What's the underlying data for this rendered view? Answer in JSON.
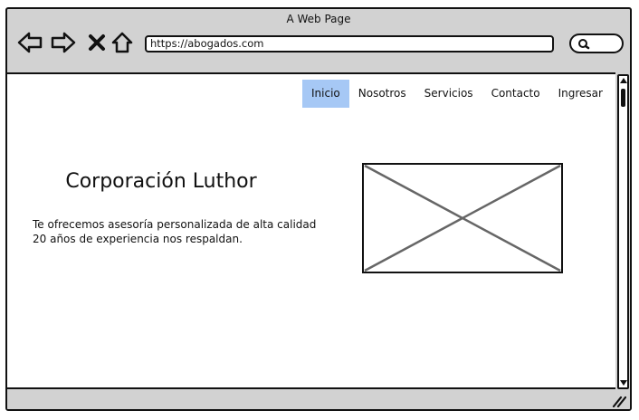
{
  "window": {
    "title": "A Web Page"
  },
  "toolbar": {
    "icons": [
      "back-icon",
      "forward-icon",
      "close-icon",
      "home-icon",
      "search-icon"
    ],
    "url": "https://abogados.com"
  },
  "nav": {
    "items": [
      {
        "label": "Inicio",
        "active": true
      },
      {
        "label": "Nosotros",
        "active": false
      },
      {
        "label": "Servicios",
        "active": false
      },
      {
        "label": "Contacto",
        "active": false
      },
      {
        "label": "Ingresar",
        "active": false
      }
    ],
    "active_color": "#a6c8f5"
  },
  "hero": {
    "title": "Corporación Luthor",
    "lines": [
      "Te ofrecemos asesoría personalizada de alta calidad",
      "20 años de experiencia nos respaldan."
    ],
    "image": "image-placeholder"
  }
}
